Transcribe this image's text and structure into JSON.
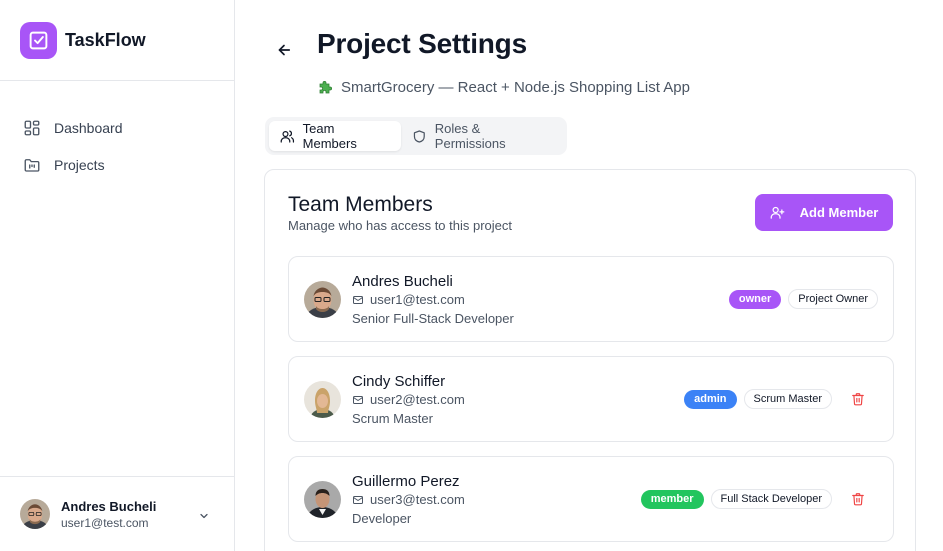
{
  "app": {
    "name": "TaskFlow",
    "accent": "#a855f7"
  },
  "sidebar": {
    "items": [
      {
        "label": "Dashboard",
        "icon": "dashboard-icon"
      },
      {
        "label": "Projects",
        "icon": "folder-icon"
      }
    ],
    "user": {
      "name": "Andres Bucheli",
      "email": "user1@test.com"
    }
  },
  "header": {
    "title": "Project Settings",
    "project_icon": "puzzle-piece-icon",
    "project_name": "SmartGrocery — React + Node.js Shopping List App"
  },
  "tabs": [
    {
      "label": "Team Members",
      "icon": "users-icon",
      "active": true
    },
    {
      "label": "Roles & Permissions",
      "icon": "shield-icon",
      "active": false
    }
  ],
  "team": {
    "title": "Team Members",
    "description": "Manage who has access to this project",
    "add_label": "Add Member",
    "members": [
      {
        "name": "Andres Bucheli",
        "email": "user1@test.com",
        "title": "Senior Full-Stack Developer",
        "role": "owner",
        "role_color": "#a855f7",
        "position": "Project Owner",
        "deletable": false
      },
      {
        "name": "Cindy Schiffer",
        "email": "user2@test.com",
        "title": "Scrum Master",
        "role": "admin",
        "role_color": "#3b82f6",
        "position": "Scrum Master",
        "deletable": true
      },
      {
        "name": "Guillermo Perez",
        "email": "user3@test.com",
        "title": "Developer",
        "role": "member",
        "role_color": "#22c55e",
        "position": "Full Stack Developer",
        "deletable": true
      }
    ]
  }
}
